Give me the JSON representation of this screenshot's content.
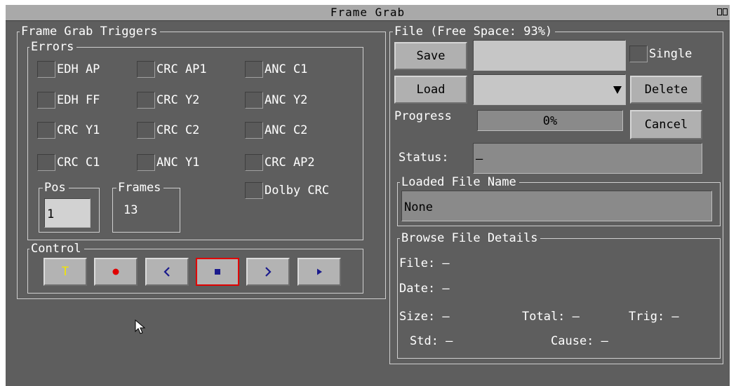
{
  "window": {
    "title": "Frame Grab"
  },
  "triggers": {
    "title": "Frame Grab Triggers",
    "errors_title": "Errors",
    "checkboxes": {
      "edh_ap": "EDH AP",
      "crc_ap1": "CRC AP1",
      "anc_c1": "ANC C1",
      "edh_ff": "EDH FF",
      "crc_y2": "CRC Y2",
      "anc_y2": "ANC Y2",
      "crc_y1": "CRC Y1",
      "crc_c2": "CRC C2",
      "anc_c2": "ANC C2",
      "crc_c1": "CRC C1",
      "anc_y1": "ANC Y1",
      "crc_ap2": "CRC AP2",
      "dolby_crc": "Dolby CRC"
    },
    "pos": {
      "label": "Pos",
      "value": "1"
    },
    "frames": {
      "label": "Frames",
      "value": "13"
    }
  },
  "control": {
    "title": "Control",
    "buttons": {
      "trigger": "T"
    },
    "colors": {
      "trigger": "#f2e600",
      "record": "#e00000",
      "nav": "#1a1a8c",
      "selected_border": "#e00000"
    }
  },
  "file": {
    "title": "File (Free Space: 93%)",
    "save_label": "Save",
    "single_label": "Single",
    "load_label": "Load",
    "delete_label": "Delete",
    "progress_label": "Progress",
    "progress_value": "0%",
    "cancel_label": "Cancel",
    "status_label": "Status:",
    "status_value": "–",
    "loaded_title": "Loaded File Name",
    "loaded_value": "None",
    "browse": {
      "title": "Browse File Details",
      "file": "File: –",
      "date": "Date: –",
      "size": "Size: –",
      "total": "Total: –",
      "trig": "Trig: –",
      "std": "Std: –",
      "cause": "Cause: –"
    }
  },
  "icons": {
    "window_controls": "restore-close-icon",
    "record": "record-icon",
    "prev": "chevron-left-icon",
    "stop": "stop-icon",
    "next": "chevron-right-icon",
    "play": "play-icon",
    "dropdown": "dropdown-arrow-icon",
    "cursor": "mouse-pointer-icon"
  }
}
